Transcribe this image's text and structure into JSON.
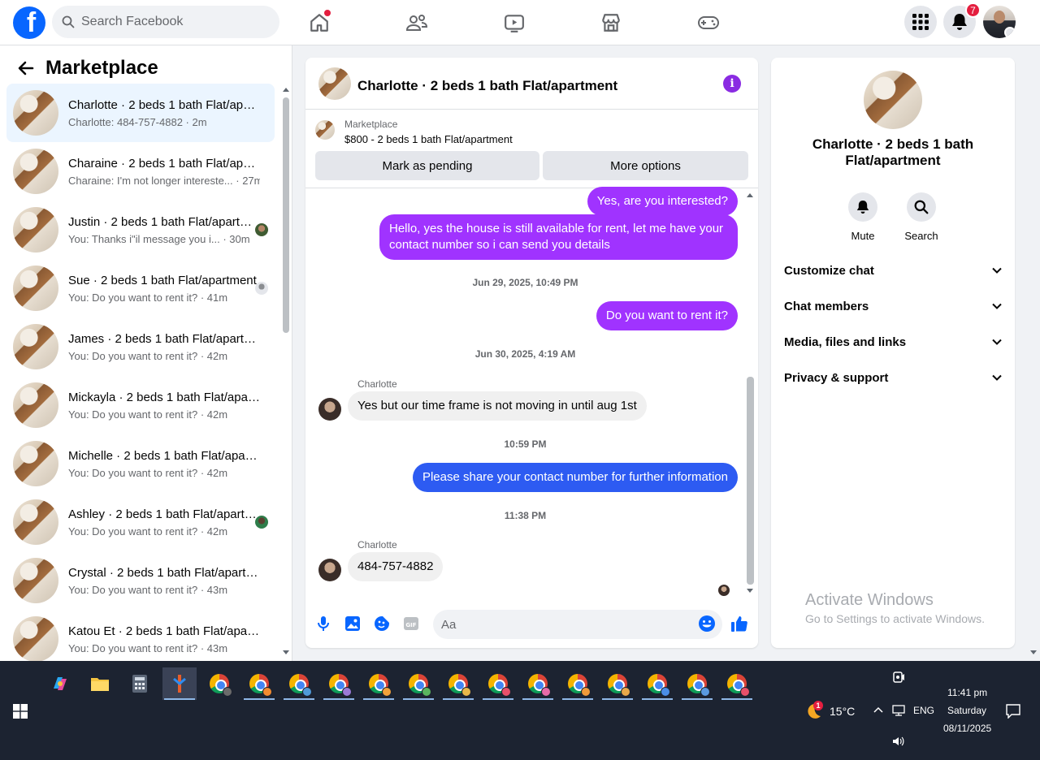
{
  "topbar": {
    "search_placeholder": "Search Facebook",
    "notification_count": "7",
    "icons": [
      "facebook-logo",
      "home-icon",
      "friends-icon",
      "video-icon",
      "marketplace-icon",
      "gaming-icon",
      "menu-grid-icon",
      "bell-icon"
    ]
  },
  "sidebar": {
    "title": "Marketplace",
    "conversations": [
      {
        "name": "Charlotte · 2 beds 1 bath Flat/apartment",
        "preview": "Charlotte: 484-757-4882 · 2m",
        "active": true
      },
      {
        "name": "Charaine · 2 beds 1 bath Flat/apartment",
        "preview": "Charaine: I'm not longer intereste... · 27m"
      },
      {
        "name": "Justin · 2 beds 1 bath Flat/apartment",
        "preview": "You: Thanks i\"il message you i... · 30m"
      },
      {
        "name": "Sue · 2 beds 1 bath Flat/apartment",
        "preview": "You: Do you want to rent it? · 41m"
      },
      {
        "name": "James · 2 beds 1 bath Flat/apartment",
        "preview": "You: Do you want to rent it? · 42m"
      },
      {
        "name": "Mickayla · 2 beds 1 bath Flat/apartment",
        "preview": "You: Do you want to rent it? · 42m"
      },
      {
        "name": "Michelle · 2 beds 1 bath Flat/apartment",
        "preview": "You: Do you want to rent it? · 42m"
      },
      {
        "name": "Ashley · 2 beds 1 bath Flat/apartment",
        "preview": "You: Do you want to rent it? · 42m"
      },
      {
        "name": "Crystal · 2 beds 1 bath Flat/apartment",
        "preview": "You: Do you want to rent it? · 43m"
      },
      {
        "name": "Katou Et · 2 beds 1 bath Flat/apartment",
        "preview": "You: Do you want to rent it? · 43m"
      }
    ]
  },
  "chat": {
    "title": "Charlotte · 2 beds 1 bath Flat/apartment",
    "listing_label": "Marketplace",
    "listing_price": "$800 - 2 beds 1 bath Flat/apartment",
    "mark_pending_label": "Mark as pending",
    "more_options_label": "More options",
    "messages": {
      "m1": "Yes, are you interested?",
      "m2": "Hello, yes the house is still available for rent, let me have your contact number so i can send you details",
      "ts1": "Jun 29, 2025, 10:49 PM",
      "m3": "Do you want to rent it?",
      "ts2": "Jun 30, 2025, 4:19 AM",
      "sender1": "Charlotte",
      "m4": "Yes but our time frame is not moving in until aug 1st",
      "ts3": "10:59 PM",
      "m5": "Please share your contact number for further information",
      "ts4": "11:38 PM",
      "sender2": "Charlotte",
      "m6": "484-757-4882"
    },
    "input_placeholder": "Aa",
    "colors": {
      "outgoing": "#a033ff",
      "outgoing_alt": "#2d5bf2",
      "accent": "#0866ff"
    }
  },
  "details": {
    "title": "Charlotte · 2 beds 1 bath Flat/apartment",
    "mute_label": "Mute",
    "search_label": "Search",
    "sections": [
      "Customize chat",
      "Chat members",
      "Media, files and links",
      "Privacy & support"
    ]
  },
  "watermark": {
    "line1": "Activate Windows",
    "line2": "Go to Settings to activate Windows."
  },
  "taskbar": {
    "temperature": "15°C",
    "language": "ENG",
    "time": "11:41 pm",
    "day": "Saturday",
    "date": "08/11/2025",
    "weather_badge": "1"
  }
}
